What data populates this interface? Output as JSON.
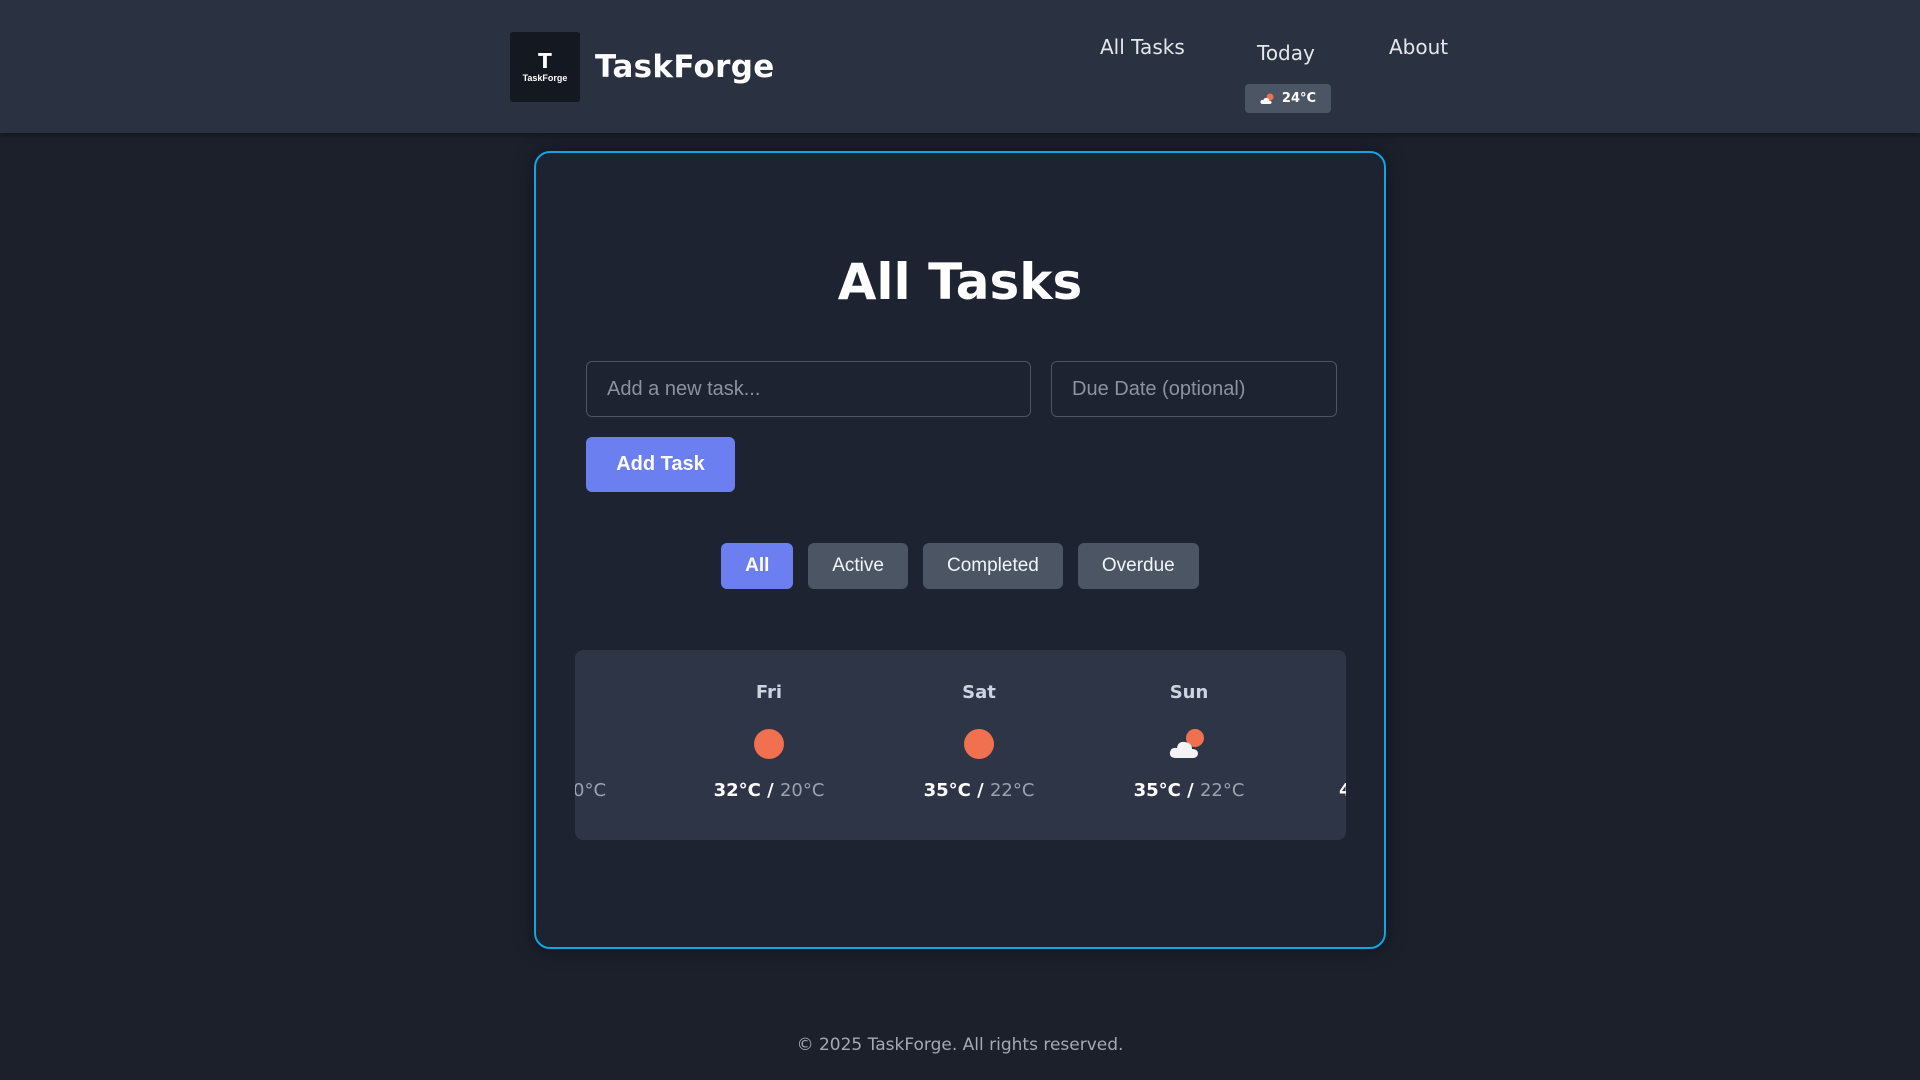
{
  "header": {
    "logo_text": "TaskForge",
    "logo_glyph": "T",
    "brand": "TaskForge",
    "nav": {
      "all_tasks": "All Tasks",
      "today": "Today",
      "about": "About"
    },
    "weather_badge": {
      "icon": "cloud-sun-icon",
      "temp": "24°C"
    }
  },
  "main": {
    "title": "All Tasks",
    "task_input_placeholder": "Add a new task...",
    "due_date_placeholder": "Due Date (optional)",
    "add_button": "Add Task",
    "filters": [
      {
        "label": "All",
        "active": true
      },
      {
        "label": "Active",
        "active": false
      },
      {
        "label": "Completed",
        "active": false
      },
      {
        "label": "Overdue",
        "active": false
      }
    ]
  },
  "forecast": {
    "partial_left": "0°C",
    "partial_right": "4",
    "days": [
      {
        "day": "Fri",
        "icon": "sun-icon",
        "high": "32°C",
        "low": "20°C"
      },
      {
        "day": "Sat",
        "icon": "sun-icon",
        "high": "35°C",
        "low": "22°C"
      },
      {
        "day": "Sun",
        "icon": "cloud-sun-icon",
        "high": "35°C",
        "low": "22°C"
      }
    ]
  },
  "colors": {
    "accent": "#6b7ff0",
    "card_border": "#0ea5e9",
    "sun": "#f07050"
  },
  "footer": {
    "text": "© 2025 TaskForge. All rights reserved."
  }
}
